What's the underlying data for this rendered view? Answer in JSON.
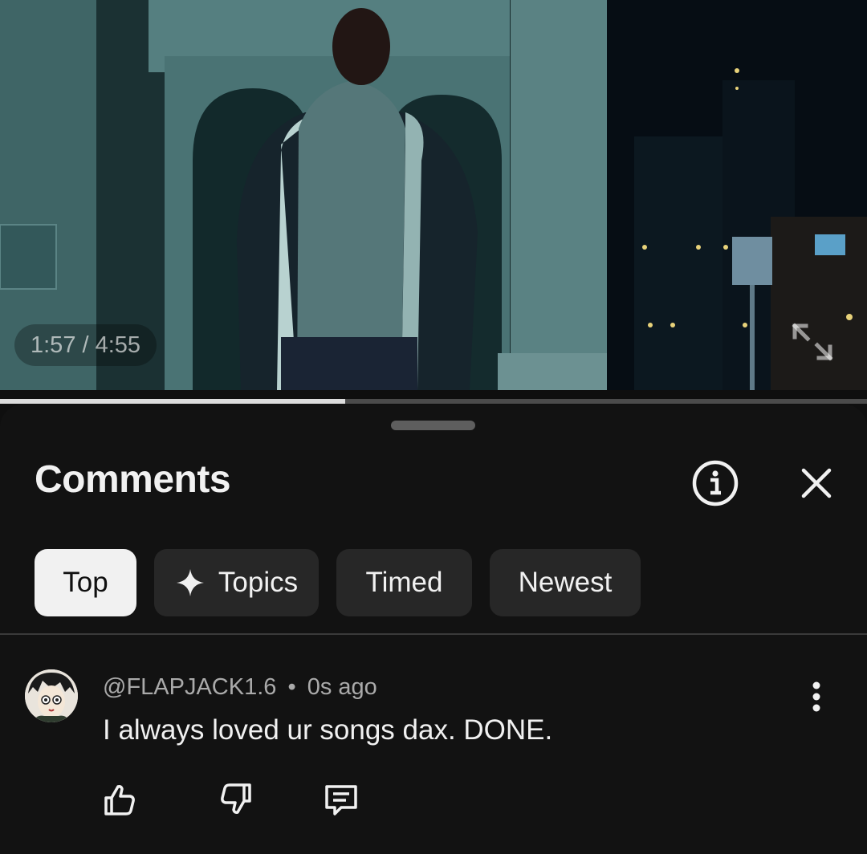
{
  "video": {
    "time_display": "1:57 / 4:55",
    "current_time": "1:57",
    "duration": "4:55",
    "progress_fraction": 0.398
  },
  "comments_panel": {
    "title": "Comments",
    "chips": [
      {
        "label": "Top",
        "active": true,
        "icon": null
      },
      {
        "label": "Topics",
        "active": false,
        "icon": "sparkle-icon"
      },
      {
        "label": "Timed",
        "active": false,
        "icon": null
      },
      {
        "label": "Newest",
        "active": false,
        "icon": null
      }
    ],
    "header_icons": [
      "info-icon",
      "close-icon"
    ]
  },
  "comment": {
    "author": "@FLAPJACK1.6",
    "separator": "•",
    "timestamp": "0s ago",
    "text": "I always loved ur songs dax. DONE.",
    "actions": [
      "like-icon",
      "dislike-icon",
      "reply-icon"
    ],
    "menu_icon": "more-vertical-icon"
  },
  "colors": {
    "background": "#0f0f0f",
    "sheet": "#121212",
    "chip": "#272727",
    "chip_active": "#f1f1f1",
    "meta_text": "#aaaaaa"
  }
}
